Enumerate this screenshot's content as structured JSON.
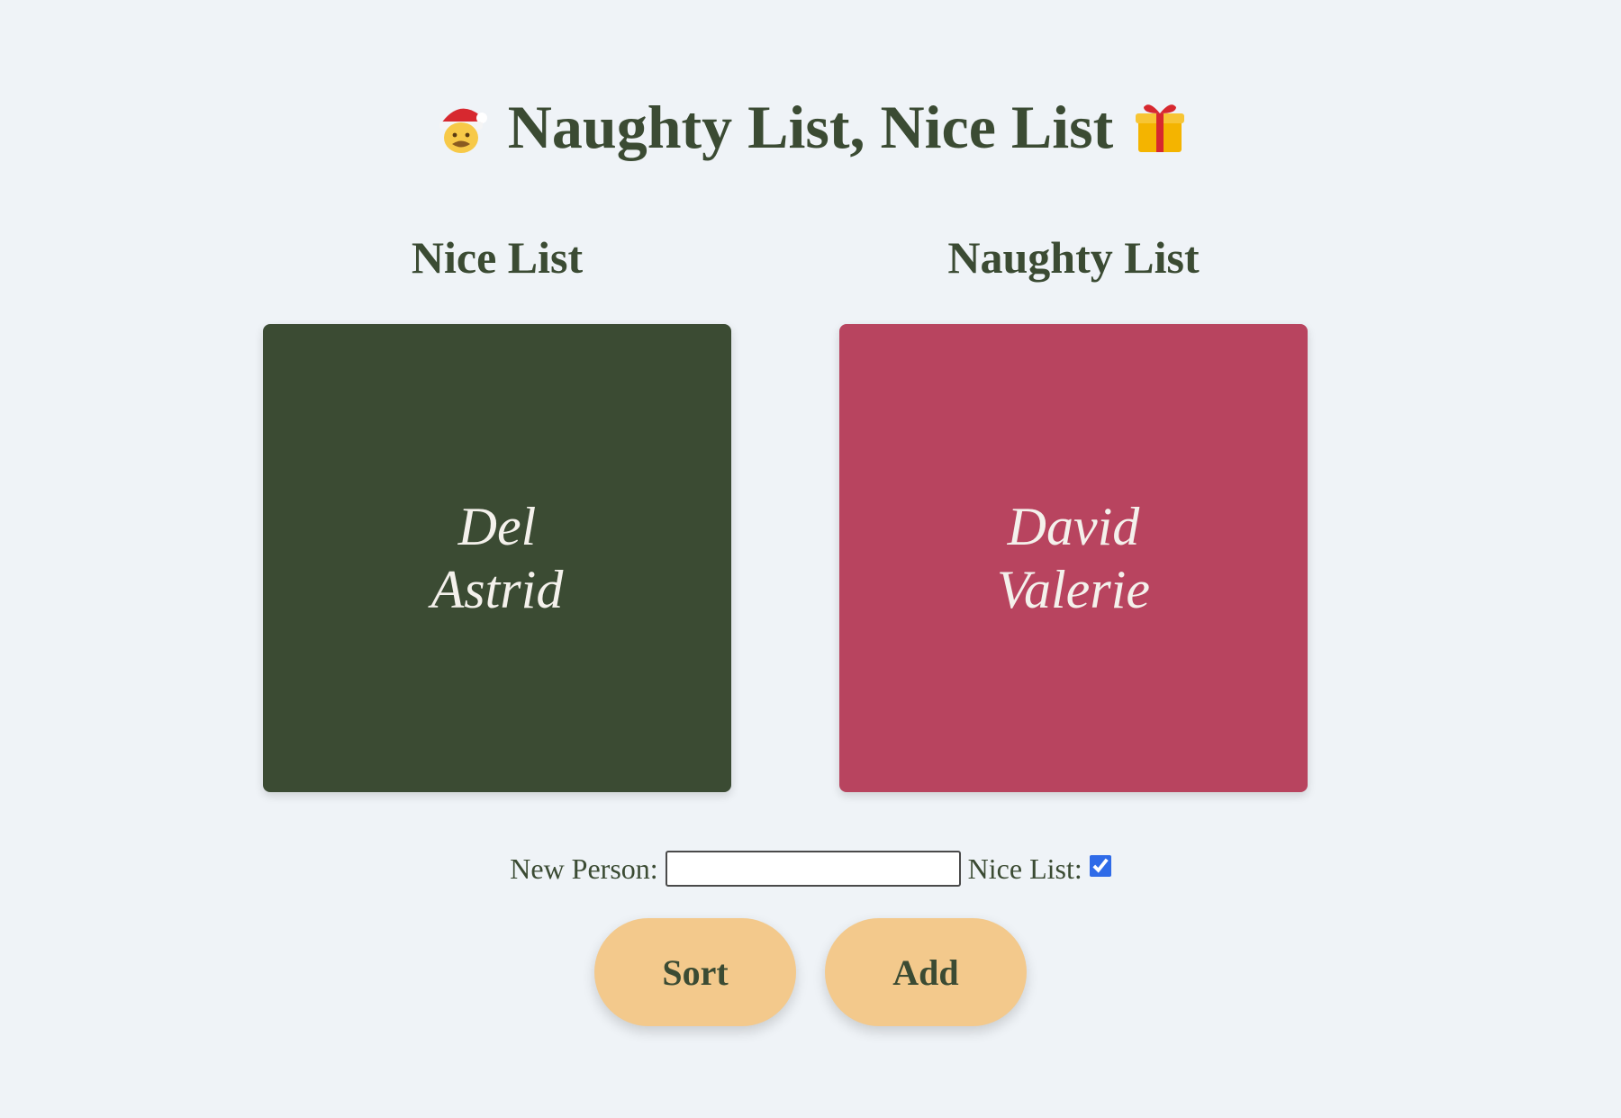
{
  "page": {
    "title": "Naughty List, Nice List",
    "left_icon": "santa-emoji",
    "right_icon": "gift-emoji"
  },
  "nice_list": {
    "heading": "Nice List",
    "names": [
      "Del",
      "Astrid"
    ],
    "color": "#3b4b33"
  },
  "naughty_list": {
    "heading": "Naughty List",
    "names": [
      "David",
      "Valerie"
    ],
    "color": "#b8445f"
  },
  "form": {
    "new_person_label": "New Person:",
    "new_person_value": "",
    "nice_list_label": "Nice List:",
    "nice_list_checked": true
  },
  "buttons": {
    "sort_label": "Sort",
    "add_label": "Add",
    "color": "#f3c98c"
  },
  "colors": {
    "background": "#eff3f7",
    "text": "#3b4b33"
  }
}
